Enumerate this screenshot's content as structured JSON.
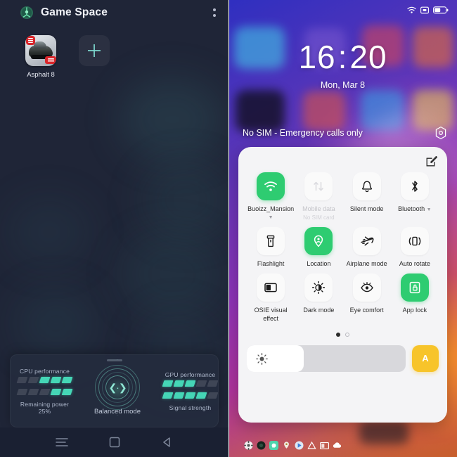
{
  "left": {
    "header": {
      "title": "Game Space",
      "logo_icon": "game-space-logo-icon",
      "menu_icon": "more-options-icon"
    },
    "apps": [
      {
        "label": "Asphalt 8",
        "icon": "asphalt-8-app-icon"
      }
    ],
    "add_button": {
      "label": "",
      "icon": "add-game-icon"
    },
    "performance": {
      "cpu_label": "CPU performance",
      "cpu_level": 3,
      "cpu_total": 5,
      "power_label": "Remaining power 25%",
      "power_level": 2,
      "power_total": 5,
      "gpu_label": "GPU performance",
      "gpu_level": 3,
      "gpu_total": 5,
      "signal_label": "Signal strength",
      "signal_level": 4,
      "signal_total": 5,
      "mode_label": "Balanced mode",
      "mode_icon": "balanced-mode-icon",
      "accent_color": "#45d6b6"
    },
    "navbar": {
      "recents_icon": "recents-icon",
      "home_icon": "home-icon",
      "back_icon": "back-icon"
    },
    "background_color": "#1f2537"
  },
  "right": {
    "status_bar": {
      "wifi_icon": "wifi-icon",
      "vowifi_icon": "vowifi-icon",
      "battery_icon": "battery-icon"
    },
    "lock": {
      "time_hours": "16",
      "time_separator": ":",
      "time_minutes": "20",
      "date": "Mon, Mar 8",
      "sim_status": "No SIM - Emergency calls only",
      "settings_icon": "settings-gear-icon"
    },
    "control_center": {
      "edit_icon": "edit-tiles-icon",
      "active_color": "#2ecc71",
      "tiles": [
        {
          "label": "Buoizz_Mansion",
          "sub": "",
          "icon": "wifi-icon",
          "state": "on",
          "caret": true
        },
        {
          "label": "Mobile data",
          "sub": "No SIM card",
          "icon": "mobile-data-icon",
          "state": "disabled",
          "caret": false
        },
        {
          "label": "Silent mode",
          "sub": "",
          "icon": "bell-icon",
          "state": "off",
          "caret": false
        },
        {
          "label": "Bluetooth",
          "sub": "",
          "icon": "bluetooth-icon",
          "state": "off",
          "caret": true
        },
        {
          "label": "Flashlight",
          "sub": "",
          "icon": "flashlight-icon",
          "state": "off",
          "caret": false
        },
        {
          "label": "Location",
          "sub": "",
          "icon": "location-pin-icon",
          "state": "on",
          "caret": false
        },
        {
          "label": "Airplane mode",
          "sub": "",
          "icon": "airplane-icon",
          "state": "off",
          "caret": false
        },
        {
          "label": "Auto rotate",
          "sub": "",
          "icon": "auto-rotate-icon",
          "state": "off",
          "caret": false
        },
        {
          "label": "OSIE visual effect",
          "sub": "",
          "icon": "osie-visual-effect-icon",
          "state": "off",
          "caret": false
        },
        {
          "label": "Dark mode",
          "sub": "",
          "icon": "dark-mode-icon",
          "state": "off",
          "caret": false
        },
        {
          "label": "Eye comfort",
          "sub": "",
          "icon": "eye-comfort-icon",
          "state": "off",
          "caret": false
        },
        {
          "label": "App lock",
          "sub": "",
          "icon": "app-lock-icon",
          "state": "on",
          "caret": false
        }
      ],
      "page_indicator": {
        "total": 2,
        "current": 1
      },
      "brightness": {
        "icon": "brightness-sun-icon",
        "value_percent": 36,
        "auto_label": "A",
        "auto_color": "#f7c42a"
      }
    },
    "notification_icons": [
      "settings-icon",
      "camera-icon",
      "whatsapp-icon",
      "location-icon",
      "play-store-icon",
      "drive-icon",
      "gallery-icon",
      "cloud-icon"
    ]
  }
}
